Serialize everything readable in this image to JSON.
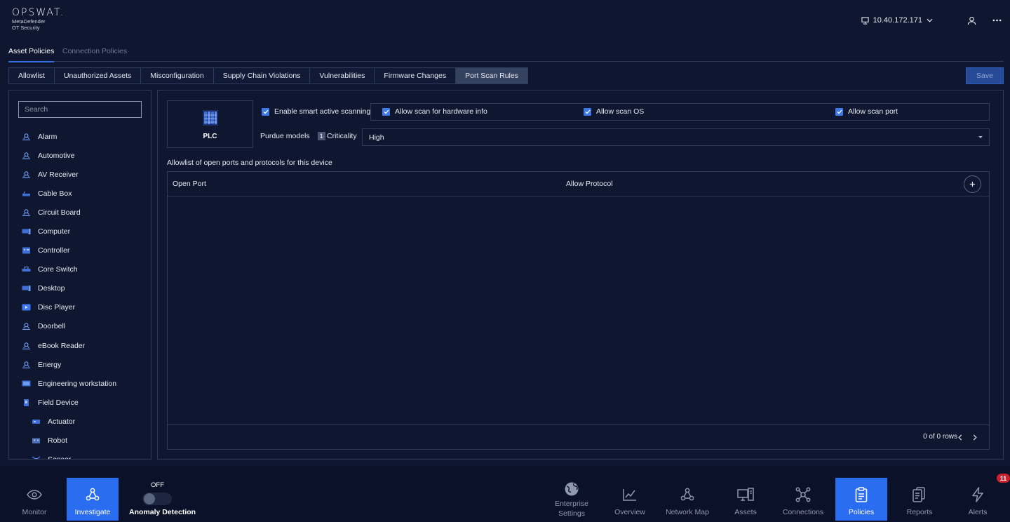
{
  "brand": {
    "name": "OPSWAT.",
    "product_line1": "MetaDefender",
    "product_line2": "OT Security"
  },
  "header": {
    "ip_address": "10.40.172.171"
  },
  "policy_tabs": [
    {
      "label": "Asset Policies",
      "active": true
    },
    {
      "label": "Connection Policies",
      "active": false
    }
  ],
  "rule_tabs": [
    {
      "label": "Allowlist",
      "active": false
    },
    {
      "label": "Unauthorized Assets",
      "active": false
    },
    {
      "label": "Misconfiguration",
      "active": false
    },
    {
      "label": "Supply Chain Violations",
      "active": false
    },
    {
      "label": "Vulnerabilities",
      "active": false
    },
    {
      "label": "Firmware Changes",
      "active": false
    },
    {
      "label": "Port Scan Rules",
      "active": true
    }
  ],
  "save_label": "Save",
  "search": {
    "placeholder": "Search",
    "value": ""
  },
  "devices": [
    {
      "label": "Alarm",
      "icon": "user-device-icon"
    },
    {
      "label": "Automotive",
      "icon": "user-device-icon"
    },
    {
      "label": "AV Receiver",
      "icon": "user-device-icon"
    },
    {
      "label": "Cable Box",
      "icon": "cable-box-icon"
    },
    {
      "label": "Circuit Board",
      "icon": "user-device-icon"
    },
    {
      "label": "Computer",
      "icon": "computer-icon"
    },
    {
      "label": "Controller",
      "icon": "controller-icon"
    },
    {
      "label": "Core Switch",
      "icon": "switch-icon"
    },
    {
      "label": "Desktop",
      "icon": "computer-icon"
    },
    {
      "label": "Disc Player",
      "icon": "disc-player-icon"
    },
    {
      "label": "Doorbell",
      "icon": "user-device-icon"
    },
    {
      "label": "eBook Reader",
      "icon": "user-device-icon"
    },
    {
      "label": "Energy",
      "icon": "user-device-icon"
    },
    {
      "label": "Engineering workstation",
      "icon": "workstation-icon"
    },
    {
      "label": "Field Device",
      "icon": "field-device-icon"
    },
    {
      "label": "Actuator",
      "icon": "actuator-icon",
      "child": true
    },
    {
      "label": "Robot",
      "icon": "robot-icon",
      "child": true
    },
    {
      "label": "Sensor",
      "icon": "sensor-icon",
      "child": true
    }
  ],
  "selected_device": {
    "label": "PLC",
    "icon": "plc-icon"
  },
  "options": {
    "smart_scan": {
      "label": "Enable smart active scanning",
      "checked": true
    },
    "hardware": {
      "label": "Allow scan for hardware info",
      "checked": true
    },
    "os": {
      "label": "Allow scan OS",
      "checked": true
    },
    "port": {
      "label": "Allow scan port",
      "checked": true
    }
  },
  "purdue": {
    "label": "Purdue models",
    "value": "1"
  },
  "criticality": {
    "label": "Criticality",
    "value": "High"
  },
  "allowlist_title": "Allowlist of open ports and protocols for this device",
  "table": {
    "col_port": "Open Port",
    "col_protocol": "Allow Protocol",
    "rows": [],
    "rows_info": "0 of 0 rows"
  },
  "bottom_nav": {
    "monitor": "Monitor",
    "investigate": "Investigate",
    "anomaly_state": "OFF",
    "anomaly_label": "Anomaly Detection",
    "enterprise_line1": "Enterprise",
    "enterprise_line2": "Settings",
    "overview": "Overview",
    "network_map": "Network Map",
    "assets": "Assets",
    "connections": "Connections",
    "policies": "Policies",
    "reports": "Reports",
    "alerts": "Alerts",
    "alerts_count": "11"
  },
  "colors": {
    "background": "#0f1730",
    "accent": "#2a6df0",
    "checkbox": "#3d7ae6",
    "badge": "#c8202c"
  }
}
